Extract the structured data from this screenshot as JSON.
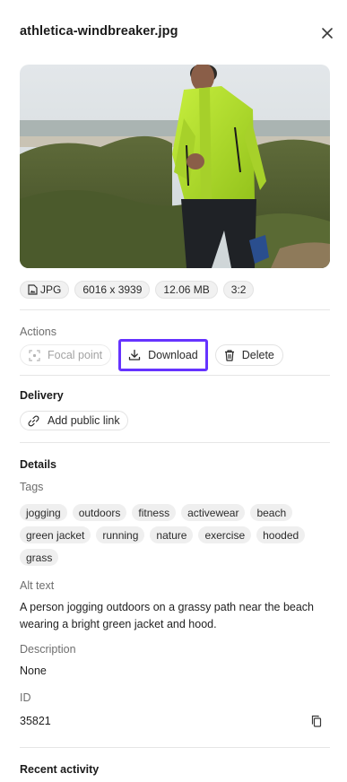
{
  "panel": {
    "file_name": "athletica-windbreaker.jpg",
    "close_icon": "close-icon"
  },
  "metadata": {
    "format": "JPG",
    "dimensions": "6016 x 3939",
    "file_size": "12.06 MB",
    "aspect_ratio": "3:2",
    "format_icon": "image-file-icon"
  },
  "actions": {
    "label": "Actions",
    "focal_point": "Focal point",
    "download": "Download",
    "delete": "Delete",
    "focus_color": "#6633ff"
  },
  "delivery": {
    "title": "Delivery",
    "add_public_link": "Add public link"
  },
  "details": {
    "title": "Details",
    "tags_label": "Tags",
    "tags": [
      "jogging",
      "outdoors",
      "fitness",
      "activewear",
      "beach",
      "green jacket",
      "running",
      "nature",
      "exercise",
      "hooded",
      "grass"
    ],
    "alt_text_label": "Alt text",
    "alt_text": "A person jogging outdoors on a grassy path near the beach wearing a bright green jacket and hood.",
    "description_label": "Description",
    "description": "None",
    "id_label": "ID",
    "id": "35821"
  },
  "recent_activity": {
    "title": "Recent activity"
  }
}
